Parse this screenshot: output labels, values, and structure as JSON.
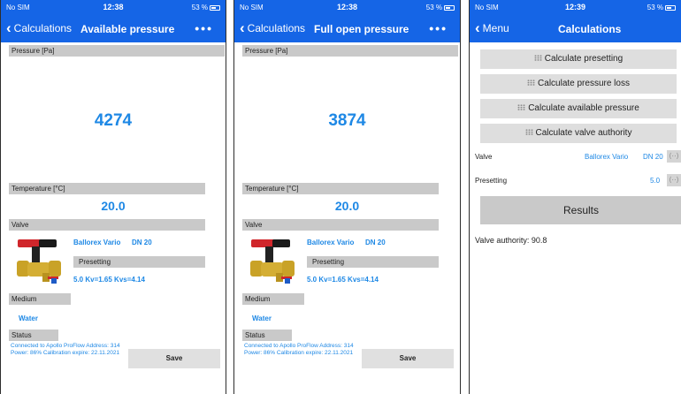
{
  "screen1": {
    "status": {
      "carrier": "No SIM",
      "time": "12:38",
      "battery": "53 %"
    },
    "nav": {
      "back": "Calculations",
      "title": "Available pressure",
      "menu": "•••"
    },
    "pressure_label": "Pressure [Pa]",
    "pressure_value": "4274",
    "temperature_label": "Temperature [°C]",
    "temperature_value": "20.0",
    "valve_label": "Valve",
    "valve_name": "Ballorex Vario",
    "valve_dn": "DN 20",
    "presetting_label": "Presetting",
    "presetting_value": "5.0 Kv=1.65 Kvs=4.14",
    "medium_label": "Medium",
    "medium_value": "Water",
    "status_label": "Status",
    "status_text": "Connected to Apollo ProFlow Address: 314 Power: 86% Calibration expire: 22.11.2021",
    "save_label": "Save"
  },
  "screen2": {
    "status": {
      "carrier": "No SIM",
      "time": "12:38",
      "battery": "53 %"
    },
    "nav": {
      "back": "Calculations",
      "title": "Full open pressure",
      "menu": "•••"
    },
    "pressure_label": "Pressure [Pa]",
    "pressure_value": "3874",
    "temperature_label": "Temperature [°C]",
    "temperature_value": "20.0",
    "valve_label": "Valve",
    "valve_name": "Ballorex Vario",
    "valve_dn": "DN 20",
    "presetting_label": "Presetting",
    "presetting_value": "5.0 Kv=1.65 Kvs=4.14",
    "medium_label": "Medium",
    "medium_value": "Water",
    "status_label": "Status",
    "status_text": "Connected to Apollo ProFlow Address: 314 Power: 86% Calibration expire: 22.11.2021",
    "save_label": "Save"
  },
  "screen3": {
    "status": {
      "carrier": "No SIM",
      "time": "12:39",
      "battery": "53 %"
    },
    "nav": {
      "back": "Menu",
      "title": "Calculations"
    },
    "buttons": [
      "Calculate presetting",
      "Calculate pressure loss",
      "Calculate available pressure",
      "Calculate valve authority"
    ],
    "valve_label": "Valve",
    "valve_value": "Ballorex Vario",
    "valve_dn": "DN 20",
    "presetting_label": "Presetting",
    "presetting_value": "5.0",
    "results_label": "Results",
    "authority_text": "Valve authority: 90.8"
  },
  "colors": {
    "accent": "#1565e6",
    "value_blue": "#1e88e5",
    "label_gray": "#c9c9c9"
  },
  "icons": [
    "chevron-left-icon",
    "more-dots-icon",
    "grid-icon",
    "swap-arrows-icon",
    "battery-icon",
    "wifi-icon"
  ]
}
